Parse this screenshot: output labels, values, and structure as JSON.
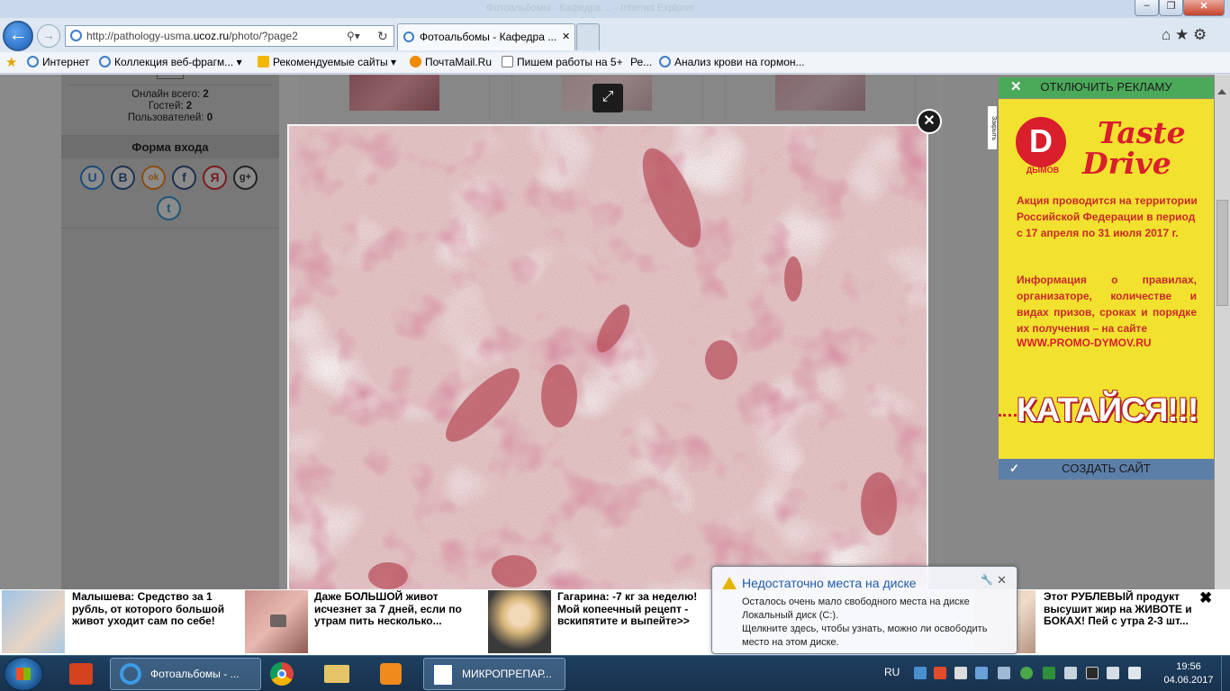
{
  "window": {
    "title": "Фотоальбомы - Кафедра ... - Internet Explorer",
    "minimize": "–",
    "maximize": "❐",
    "close": "✕"
  },
  "nav": {
    "back_icon": "arrow-left-icon",
    "forward_icon": "arrow-right-icon",
    "url_prefix": "http://pathology-usma.",
    "url_domain": "ucoz.ru",
    "url_suffix": "/photo/?page2",
    "search_icon": "⚲▾",
    "refresh_icon": "↻",
    "tab_active": "Фотоальбомы - Кафедра ...",
    "tab_close": "✕",
    "right_icons": "⌂ ★ ⚙"
  },
  "favorites": {
    "star_label": "Избранное",
    "items": [
      "Интернет",
      "Коллекция веб-фрагм...",
      "Рекомендуемые сайты",
      "ПочтаMail.Ru",
      "Пишем работы на 5+",
      "Ре...",
      "Анализ крови на гормон..."
    ]
  },
  "sidebar": {
    "online_total_label": "Онлайн всего:",
    "online_total": "2",
    "guests_label": "Гостей:",
    "guests": "2",
    "users_label": "Пользователей:",
    "users": "0",
    "login_title": "Форма входа",
    "social": [
      "U",
      "B",
      "ok",
      "f",
      "Я",
      "g+",
      "t"
    ]
  },
  "lightbox": {
    "close": "✕",
    "expand": "⤢"
  },
  "ad": {
    "disable_ads": "ОТКЛЮЧИТЬ РЕКЛАМУ",
    "disable_x": "✕",
    "close_label": "Закрыть",
    "brand_letter": "D",
    "brand_name": "ДЫМОВ",
    "taste": "Taste",
    "drive": "Drive",
    "promo1": "Акция проводится на территории Российской Федерации в период с 17 апреля по 31 июля 2017 г.",
    "promo2": "Информация о правилах, организаторе, количестве и видах призов, сроках и порядке их получения – на сайте",
    "url": "WWW.PROMO-DYMOV.RU",
    "slogan": "КАТАЙСЯ!!!",
    "create_site": "СОЗДАТЬ САЙТ",
    "create_check": "✓",
    "colors": {
      "green": "#4ba95a",
      "yellow": "#f2e12e",
      "red": "#d91e2c",
      "blue": "#5c7fa8"
    }
  },
  "news": {
    "items": [
      "Малышева: Средство за 1 рубль, от которого большой живот уходит сам по себе!",
      "Даже БОЛЬШОЙ живот исчезнет за 7 дней, если по утрам пить несколько...",
      "Гагарина: -7 кг за неделю! Мой копеечный рецепт - вскипятите и выпейте>>",
      "Этот РУБЛЕВЫЙ продукт высушит жир на ЖИВОТЕ и БОКАХ! Пей с утра 2-3 шт..."
    ],
    "close": "✖"
  },
  "balloon": {
    "title": "Недостаточно места на диске",
    "line1": "Осталось очень мало свободного места на диске",
    "line2": "Локальный диск (C:).",
    "line3": "Щелкните здесь, чтобы узнать, можно ли освободить место на этом диске.",
    "close": "✕",
    "settings_icon": "wrench-icon"
  },
  "taskbar": {
    "ie_task": "Фотоальбомы - ...",
    "word_task": "МИКРОПРЕПАР...",
    "lang": "RU",
    "time": "19:56",
    "date": "04.06.2017"
  }
}
